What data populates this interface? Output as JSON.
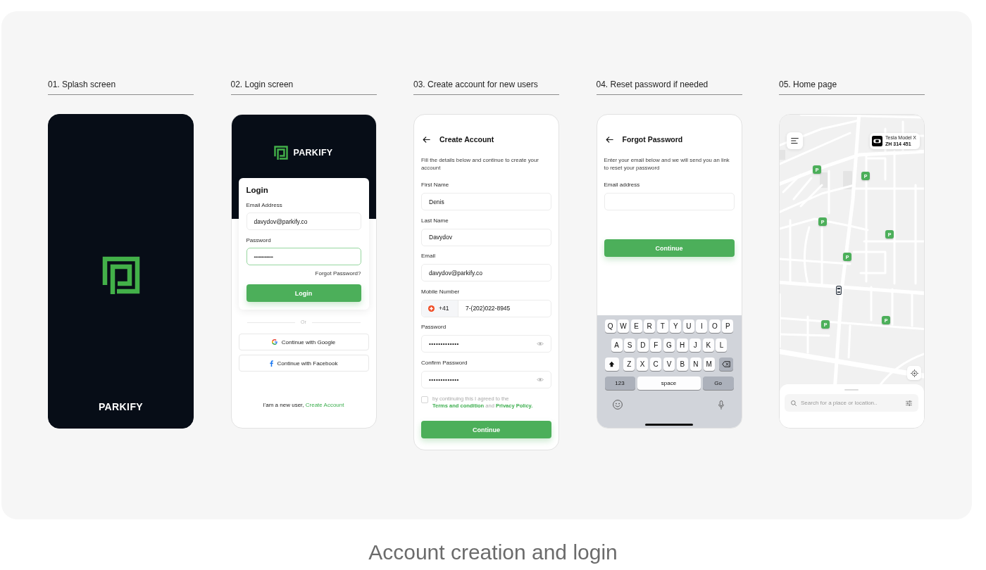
{
  "screens": [
    {
      "kind": "splash",
      "heading": "01. Splash screen",
      "brand": "PARKIFY"
    },
    {
      "kind": "login",
      "heading": "02. Login screen",
      "brand": "PARKIFY",
      "card_title": "Login",
      "fields": [
        {
          "label": "Email Address",
          "value": "davydov@parkify.co",
          "focused": false
        },
        {
          "label": "Password",
          "value": "•••••••••••••••",
          "focused": true
        }
      ],
      "forgot_link": "Forgot Password?",
      "submit_button": "Login",
      "divider": "Or",
      "social_buttons": [
        {
          "kind": "google",
          "label": "Continue with Google"
        },
        {
          "kind": "facebook",
          "label": "Continue with Facebook"
        }
      ],
      "signup_prompt": {
        "text": "I'am a new user,",
        "link": "Create Account"
      }
    },
    {
      "kind": "create_account",
      "heading": "03. Create account for new users",
      "title": "Create Account",
      "description": "Fill the details below and continue to create your account",
      "fields": [
        {
          "kind": "text",
          "label": "First Name",
          "value": "Denis"
        },
        {
          "kind": "text",
          "label": "Last Name",
          "value": "Davydov"
        },
        {
          "kind": "text",
          "label": "Email",
          "value": "davydov@parkify.co"
        },
        {
          "kind": "phone",
          "label": "Mobile Number",
          "country_code": "+41",
          "value": "7-(202)022-8945"
        },
        {
          "kind": "password",
          "label": "Password",
          "value": "•••••••••••••"
        },
        {
          "kind": "password",
          "label": "Confirm Password",
          "value": "•••••••••••••"
        }
      ],
      "agreement": {
        "checked": false,
        "parts": [
          {
            "kind": "text",
            "text": "by continuing this I agreed to the"
          },
          {
            "kind": "link",
            "text": "Terms and condition"
          },
          {
            "kind": "text",
            "text": "and"
          },
          {
            "kind": "link",
            "text": "Privacy Policy."
          }
        ]
      },
      "submit_button": "Continue"
    },
    {
      "kind": "forgot_password",
      "heading": "04. Reset password if needed",
      "title": "Forgot Password",
      "description": "Enter your email below and we will send you an link to reset your password",
      "fields": [
        {
          "kind": "text",
          "label": "Email address"
        }
      ],
      "submit_button": "Continue",
      "keyboard": {
        "letter_rows": [
          [
            {
              "kind": "char",
              "label": "Q"
            },
            {
              "kind": "char",
              "label": "W"
            },
            {
              "kind": "char",
              "label": "E"
            },
            {
              "kind": "char",
              "label": "R"
            },
            {
              "kind": "char",
              "label": "T"
            },
            {
              "kind": "char",
              "label": "Y"
            },
            {
              "kind": "char",
              "label": "U"
            },
            {
              "kind": "char",
              "label": "I"
            },
            {
              "kind": "char",
              "label": "O"
            },
            {
              "kind": "char",
              "label": "P"
            }
          ],
          [
            {
              "kind": "char",
              "label": "A"
            },
            {
              "kind": "char",
              "label": "S"
            },
            {
              "kind": "char",
              "label": "D"
            },
            {
              "kind": "char",
              "label": "F"
            },
            {
              "kind": "char",
              "label": "G"
            },
            {
              "kind": "char",
              "label": "H"
            },
            {
              "kind": "char",
              "label": "J"
            },
            {
              "kind": "char",
              "label": "K"
            },
            {
              "kind": "char",
              "label": "L"
            }
          ],
          [
            {
              "kind": "shift"
            },
            {
              "kind": "char",
              "label": "Z"
            },
            {
              "kind": "char",
              "label": "X"
            },
            {
              "kind": "char",
              "label": "C"
            },
            {
              "kind": "char",
              "label": "V"
            },
            {
              "kind": "char",
              "label": "B"
            },
            {
              "kind": "char",
              "label": "N"
            },
            {
              "kind": "char",
              "label": "M"
            },
            {
              "kind": "backspace"
            }
          ]
        ],
        "bottom_keys": [
          {
            "kind": "mode",
            "label": "123"
          },
          {
            "kind": "space",
            "label": "space"
          },
          {
            "kind": "go",
            "label": "Go"
          }
        ]
      }
    },
    {
      "kind": "home",
      "heading": "05. Home page",
      "vehicle": {
        "model": "Tesla Model X",
        "plate": "ZH 314 451"
      },
      "parking_markers": [
        {
          "label": "P"
        },
        {
          "label": "P"
        },
        {
          "label": "P"
        },
        {
          "label": "P"
        },
        {
          "label": "P"
        },
        {
          "label": "P"
        },
        {
          "label": "P"
        }
      ],
      "search": {
        "placeholder": "Search for a place or location.."
      }
    }
  ],
  "caption": "Account creation and login"
}
